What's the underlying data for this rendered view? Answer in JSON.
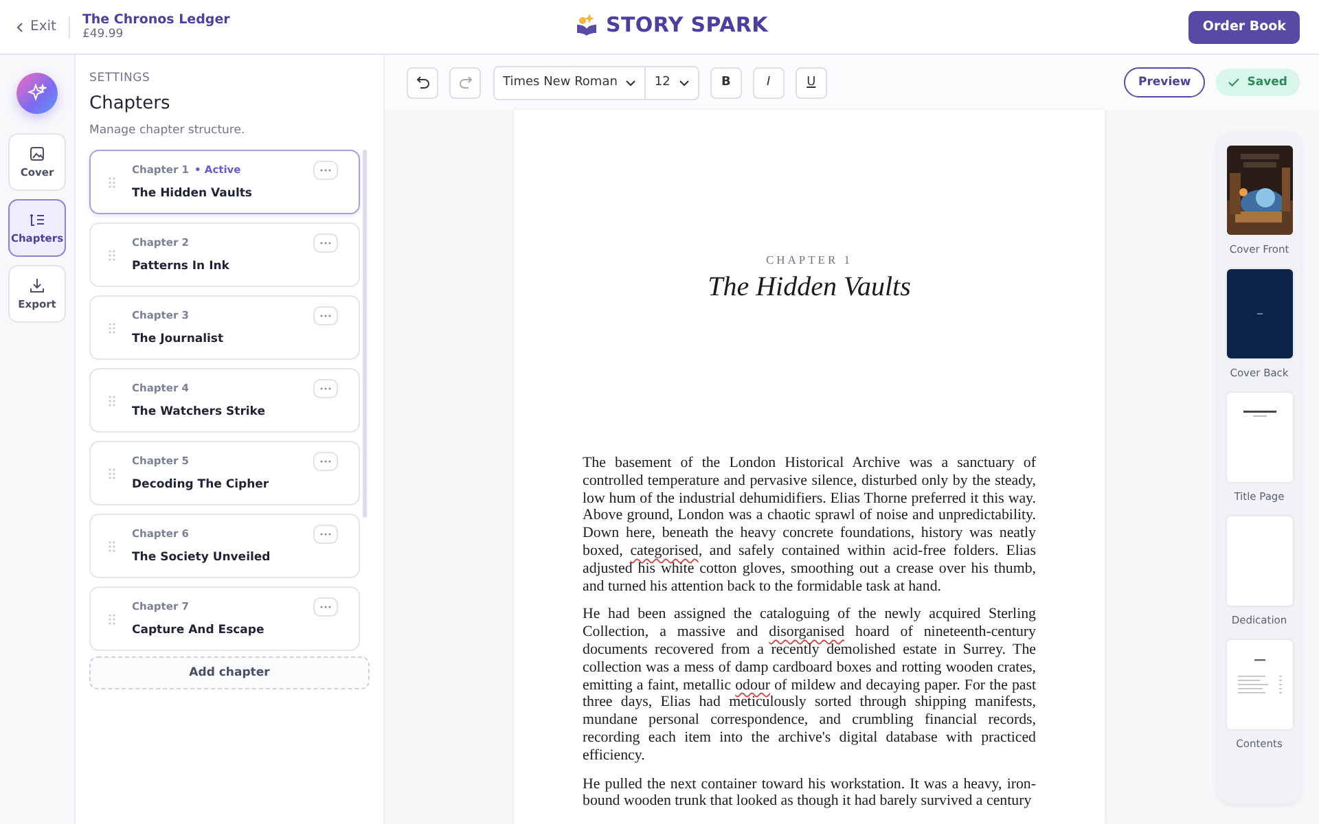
{
  "header": {
    "exit_label": "Exit",
    "book_title": "The Chronos Ledger",
    "price": "£49.99",
    "brand": "STORY SPARK",
    "order_button": "Order Book"
  },
  "rail": [
    {
      "label": "Cover",
      "selected": false
    },
    {
      "label": "Chapters",
      "selected": true
    },
    {
      "label": "Export",
      "selected": false
    }
  ],
  "settings": {
    "section": "SETTINGS",
    "title": "Chapters",
    "description": "Manage chapter structure.",
    "add_button": "Add chapter",
    "chapters": [
      {
        "number": "Chapter 1",
        "status": "• Active",
        "title": "The Hidden Vaults",
        "selected": true
      },
      {
        "number": "Chapter 2",
        "title": "Patterns In Ink",
        "selected": false
      },
      {
        "number": "Chapter 3",
        "title": "The Journalist",
        "selected": false
      },
      {
        "number": "Chapter 4",
        "title": "The Watchers Strike",
        "selected": false
      },
      {
        "number": "Chapter 5",
        "title": "Decoding The Cipher",
        "selected": false
      },
      {
        "number": "Chapter 6",
        "title": "The Society Unveiled",
        "selected": false
      },
      {
        "number": "Chapter 7",
        "title": "Capture And Escape",
        "selected": false
      }
    ]
  },
  "toolbar": {
    "font": "Times New Roman",
    "size": "12",
    "bold": "B",
    "italic": "I",
    "underline": "U",
    "preview": "Preview",
    "saved": "Saved"
  },
  "document": {
    "chapter_label": "CHAPTER 1",
    "title": "The Hidden Vaults",
    "paragraphs": [
      [
        {
          "text": "The basement of the London Historical Archive was a sanctuary of controlled temperature and pervasive silence, disturbed only by the steady, low hum of the industrial dehumidifiers. Elias Thorne preferred it this way. Above ground, London was a chaotic sprawl of noise and unpredictability. Down here, beneath the heavy concrete foundations, history was neatly boxed, ",
          "misspelled": false
        },
        {
          "text": "categorised",
          "misspelled": true
        },
        {
          "text": ", and safely contained within acid-free folders. Elias adjusted his white cotton gloves, smoothing out a crease over his thumb, and turned his attention back to the formidable task at hand.",
          "misspelled": false
        }
      ],
      [
        {
          "text": "He had been assigned the cataloguing of the newly acquired Sterling Collection, a massive and ",
          "misspelled": false
        },
        {
          "text": "disorganised",
          "misspelled": true
        },
        {
          "text": " hoard of nineteenth-century documents recovered from a recently demolished estate in Surrey. The collection was a mess of damp cardboard boxes and rotting wooden crates, emitting a faint, metallic ",
          "misspelled": false
        },
        {
          "text": "odour",
          "misspelled": true
        },
        {
          "text": " of mildew and decaying paper. For the past three days, Elias had meticulously sorted through shipping manifests, mundane personal correspondence, and crumbling financial records, recording each item into the archive's digital database with practiced efficiency.",
          "misspelled": false
        }
      ],
      [
        {
          "text": "He pulled the next container toward his workstation. It was a heavy, iron-bound wooden trunk that looked as though it had barely survived a century",
          "misspelled": false
        }
      ]
    ]
  },
  "pages": [
    {
      "label": "Cover Front",
      "kind": "cover-front"
    },
    {
      "label": "Cover Back",
      "kind": "cover-back"
    },
    {
      "label": "Title Page",
      "kind": "title-page"
    },
    {
      "label": "Dedication",
      "kind": "blank"
    },
    {
      "label": "Contents",
      "kind": "contents"
    }
  ]
}
